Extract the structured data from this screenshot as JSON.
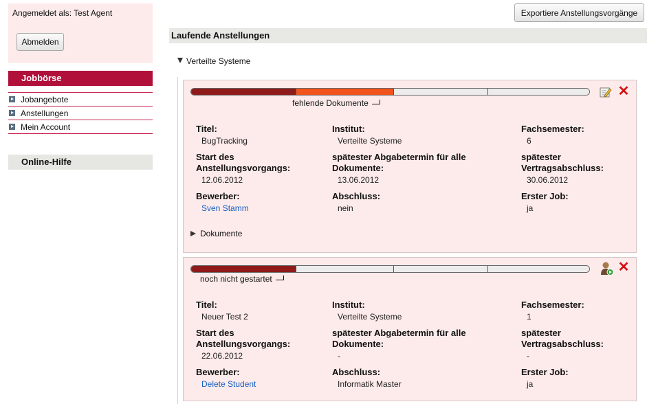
{
  "sidebar": {
    "logged_in_text": "Angemeldet als: Test Agent",
    "logout_label": "Abmelden",
    "jobboerse_title": "Jobbörse",
    "nav_items": [
      {
        "label": "Jobangebote"
      },
      {
        "label": "Anstellungen"
      },
      {
        "label": "Mein Account"
      }
    ],
    "help_title": "Online-Hilfe"
  },
  "main": {
    "export_label": "Exportiere Anstellungsvorgänge",
    "section_title": "Laufende Anstellungen",
    "group_label": "Verteilte Systeme",
    "field_labels": {
      "titel": "Titel:",
      "institut": "Institut:",
      "fachsemester": "Fachsemester:",
      "start_l1": "Start des",
      "start_l2": "Anstellungsvorgangs:",
      "abgabe_l1": "spätester Abgabetermin für alle",
      "abgabe_l2": "Dokumente:",
      "vertrag_l1": "spätester",
      "vertrag_l2": "Vertragsabschluss:",
      "bewerber": "Bewerber:",
      "abschluss": "Abschluss:",
      "erster_job": "Erster Job:"
    },
    "cards": [
      {
        "status": "fehlende Dokumente",
        "progress_completed_segments": 1,
        "progress_current_segment": 2,
        "progress_total_segments": 4,
        "titel": "BugTracking",
        "institut": "Verteilte Systeme",
        "fachsemester": "6",
        "start": "12.06.2012",
        "abgabe": "13.06.2012",
        "vertrag": "30.06.2012",
        "bewerber": "Sven Stamm",
        "abschluss": "nein",
        "erster_job": "ja",
        "documents_label": "Dokumente",
        "action_icons": [
          "edit-icon",
          "delete-icon"
        ]
      },
      {
        "status": "noch nicht gestartet",
        "progress_completed_segments": 1,
        "progress_current_segment": 0,
        "progress_total_segments": 4,
        "titel": "Neuer Test 2",
        "institut": "Verteilte Systeme",
        "fachsemester": "1",
        "start": "22.06.2012",
        "abgabe": "-",
        "vertrag": "-",
        "bewerber": "Delete Student",
        "abschluss": "Informatik Master",
        "erster_job": "ja",
        "action_icons": [
          "start-process-icon",
          "delete-icon"
        ]
      }
    ]
  },
  "colors": {
    "accent_red": "#b0103a",
    "progress_dark": "#8e1a1a",
    "progress_orange": "#f1531b",
    "card_bg": "#fdeaea",
    "link": "#1660c4"
  }
}
